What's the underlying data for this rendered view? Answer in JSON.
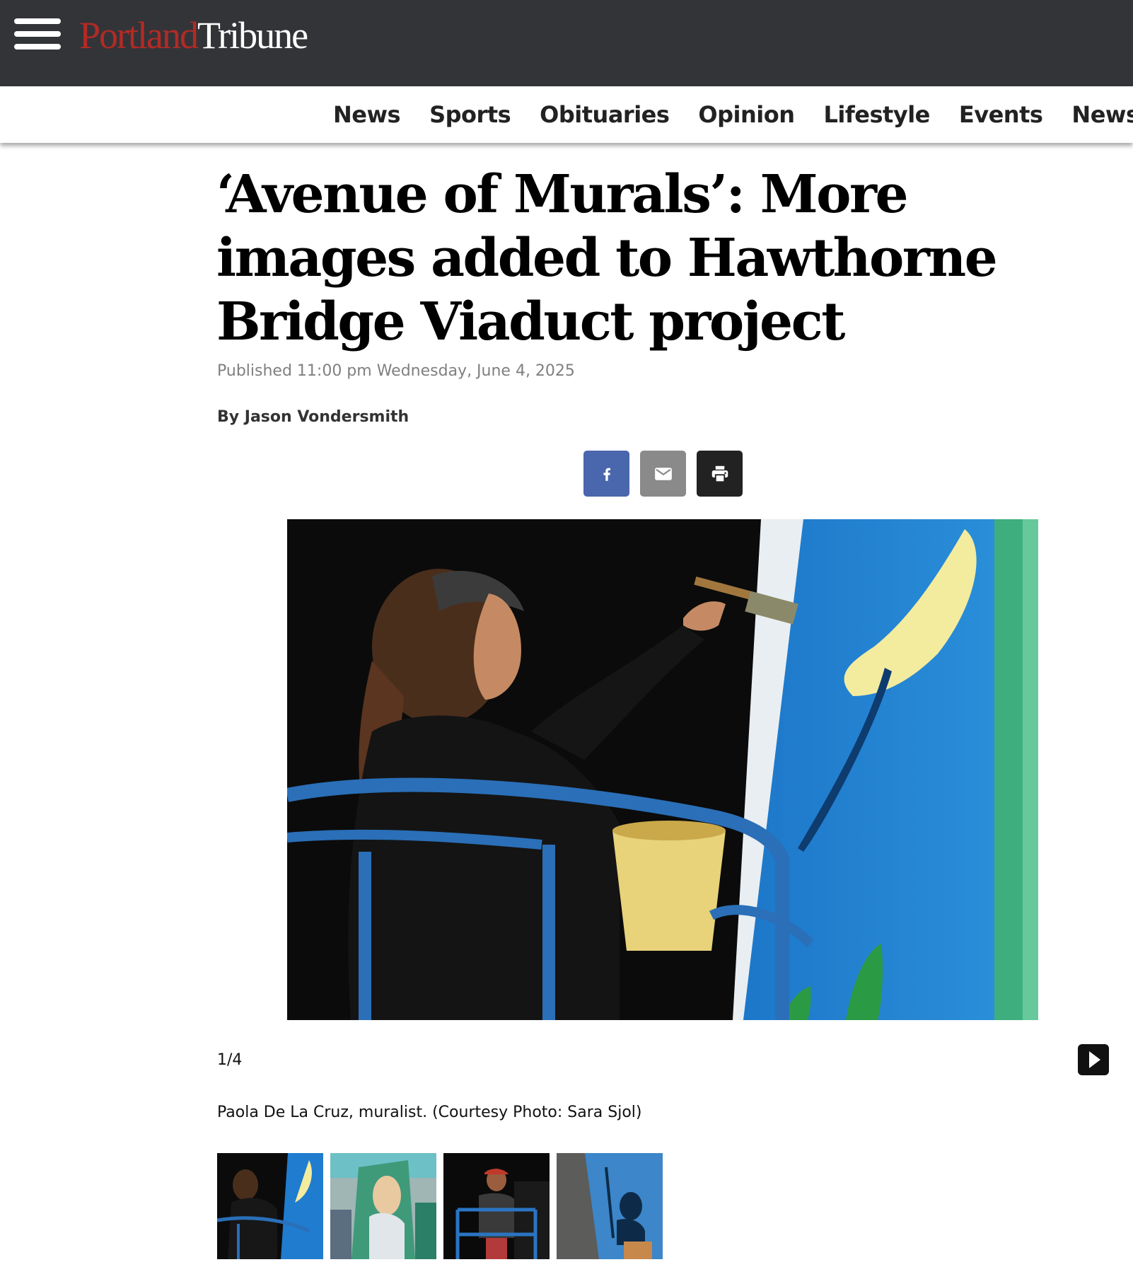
{
  "header": {
    "menu_icon": "hamburger-menu-icon",
    "logo_part1": "Portland",
    "logo_part2": "Tribune",
    "logo_colors": {
      "part1": "#b32a25",
      "part2": "#ffffff",
      "bar": "#333438"
    }
  },
  "nav": {
    "items": [
      "News",
      "Sports",
      "Obituaries",
      "Opinion",
      "Lifestyle",
      "Events",
      "Newsletters"
    ]
  },
  "article": {
    "headline": "‘Avenue of Murals’: More images added to Hawthorne Bridge Viaduct project",
    "published": "Published 11:00 pm Wednesday, June 4, 2025",
    "byline": "By Jason Vondersmith"
  },
  "share": {
    "facebook_icon": "facebook-icon",
    "email_icon": "email-icon",
    "print_icon": "print-icon",
    "colors": {
      "facebook": "#4a66ad",
      "email": "#8a8a8a",
      "print": "#222222"
    }
  },
  "gallery": {
    "counter": "1/4",
    "caption": "Paola De La Cruz, muralist. (Courtesy Photo: Sara Sjol)",
    "next_icon": "play-next-icon",
    "thumbnail_count": 4
  }
}
